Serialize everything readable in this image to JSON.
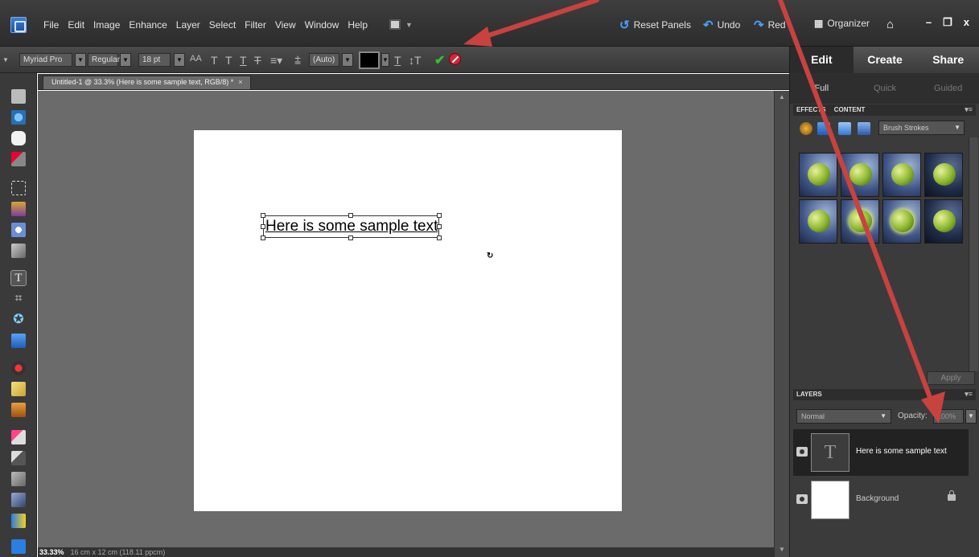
{
  "menubar": {
    "items": [
      "File",
      "Edit",
      "Image",
      "Enhance",
      "Layer",
      "Select",
      "Filter",
      "View",
      "Window",
      "Help"
    ],
    "reset_panels": "Reset Panels",
    "undo": "Undo",
    "redo": "Red",
    "organizer": "Organizer"
  },
  "options": {
    "font_family": "Myriad Pro",
    "font_style": "Regular",
    "font_size": "18 pt",
    "leading": "(Auto)",
    "text_color": "#000000"
  },
  "document": {
    "tab_title": "Untitled-1 @ 33.3% (Here is some sample text, RGB/8) *",
    "text_layer_content": "Here is some sample text",
    "zoom": "33.33%",
    "doc_size": "16 cm x 12 cm (118.11 ppcm)"
  },
  "panel": {
    "main_tabs": [
      "Edit",
      "Create",
      "Share"
    ],
    "sub_tabs": [
      "Full",
      "Quick",
      "Guided"
    ],
    "effects_header": "EFFECTS",
    "content_header": "CONTENT",
    "effects_dropdown": "Brush Strokes",
    "apply": "Apply",
    "layers_header": "LAYERS",
    "blend_mode": "Normal",
    "opacity_label": "Opacity:",
    "opacity_value": "100%",
    "layers": [
      {
        "name": "Here is some sample text",
        "type": "text"
      },
      {
        "name": "Background",
        "type": "image"
      }
    ]
  },
  "colors": {
    "annotation_arrow": "#c8423f",
    "commit": "#39c12b",
    "cancel": "#d6243a"
  }
}
